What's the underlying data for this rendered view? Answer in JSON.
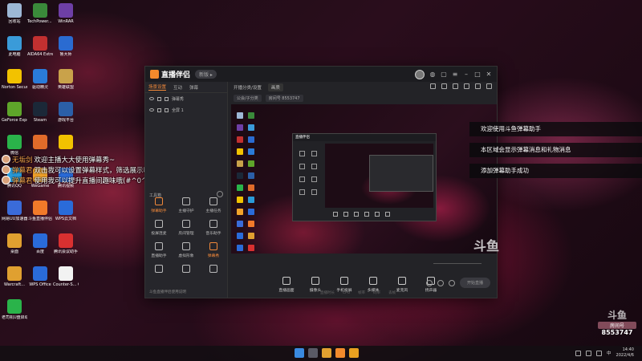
{
  "desktop": {
    "icons": [
      {
        "label": "回收站",
        "color": "#9db8d6"
      },
      {
        "label": "TechPower... GPU-Z",
        "color": "#3a8a3a"
      },
      {
        "label": "WinRAR",
        "color": "#6e3fa6"
      },
      {
        "label": "此电脑",
        "color": "#3a9bd9"
      },
      {
        "label": "AIDA64 Extreme",
        "color": "#c23030"
      },
      {
        "label": "鲁大师",
        "color": "#2a6bd1"
      },
      {
        "label": "Norton Security",
        "color": "#f2c200"
      },
      {
        "label": "驱动精灵",
        "color": "#2a7bd9"
      },
      {
        "label": "英雄联盟",
        "color": "#c9a24a"
      },
      {
        "label": "GeForce Experience",
        "color": "#5ea52a"
      },
      {
        "label": "Steam",
        "color": "#1b2838"
      },
      {
        "label": "游戏平台",
        "color": "#2b5fa8"
      },
      {
        "label": "微信",
        "color": "#2ab34a"
      },
      {
        "label": "",
        "color": "#e06b2a"
      },
      {
        "label": "",
        "color": "#f2c200"
      },
      {
        "label": "腾讯QQ",
        "color": "#2a9bd9"
      },
      {
        "label": "WeGame",
        "color": "#f2a32a"
      },
      {
        "label": "腾讯视频",
        "color": "#2a6bd9"
      },
      {
        "label": "网易UU加速器",
        "color": "#3a6bd9"
      },
      {
        "label": "斗鱼直播伴侣",
        "color": "#f27a2a"
      },
      {
        "label": "WPS云文档",
        "color": "#2a6bd9"
      },
      {
        "label": "桌面",
        "color": "#e0a030"
      },
      {
        "label": "百度",
        "color": "#2a6bd9"
      },
      {
        "label": "腾讯会议助手",
        "color": "#d93030"
      },
      {
        "label": "Warcraft...",
        "color": "#e0a030"
      },
      {
        "label": "WPS Office",
        "color": "#2a6bd9"
      },
      {
        "label": "Counter-S... Global Off...",
        "color": "#f2f2f2"
      },
      {
        "label": "老司机U盘启动器工具",
        "color": "#2ab34a"
      }
    ]
  },
  "chat": [
    {
      "nick": "无垢剑",
      "text": "欢迎主播大大使用弹幕秀~"
    },
    {
      "nick": "弹幕君",
      "text": "双击我可以设置弹幕样式，筛选展示哦~"
    },
    {
      "nick": "弹幕君",
      "text": "使用我可以提升直播间趣味哦(#^0^#)"
    }
  ],
  "app": {
    "title": "直播伴侣",
    "version_badge": "新版 ▸",
    "left_tabs": [
      "场景设置",
      "互动",
      "弹幕"
    ],
    "scenes": [
      "弹幕秀",
      "全屏 1"
    ],
    "tools_label": "工具箱",
    "tools": [
      {
        "label": "弹幕助手",
        "highlight": true
      },
      {
        "label": "主播守护",
        "highlight": false
      },
      {
        "label": "主播任务",
        "highlight": false
      },
      {
        "label": "投屏连麦",
        "highlight": false
      },
      {
        "label": "房间管理",
        "highlight": false
      },
      {
        "label": "音乐助手",
        "highlight": false
      },
      {
        "label": "直播助手",
        "highlight": false
      },
      {
        "label": "虚拟形象",
        "highlight": false
      },
      {
        "label": "弹幕秀",
        "highlight": true
      },
      {
        "label": "",
        "highlight": false
      },
      {
        "label": "",
        "highlight": false
      },
      {
        "label": "",
        "highlight": false
      }
    ],
    "bottom_hint": "斗鱼直播伴侣使用说明",
    "scene_tabs": [
      "开播分类/设置",
      "画质"
    ],
    "options": [
      "公会/子分类",
      "房间号 8553747"
    ],
    "controls": [
      "直播画面",
      "摄像头",
      "手机投屏",
      "多媒体",
      "麦克风",
      "扬声器"
    ],
    "start_button": "开始直播",
    "status": [
      "直播时长",
      "CPU",
      "帧率",
      "码率",
      "丢帧"
    ]
  },
  "toasts": [
    "欢迎使用斗鱼弹幕助手",
    "本区域会显示弹幕消息和礼物消息",
    "添加弹幕助手成功"
  ],
  "watermark": {
    "mark": "斗鱼",
    "room_label": "房间号",
    "room_id": "8553747"
  },
  "taskbar": {
    "tray_lang": "中",
    "time": "14:40",
    "date": "2022/4/6"
  }
}
